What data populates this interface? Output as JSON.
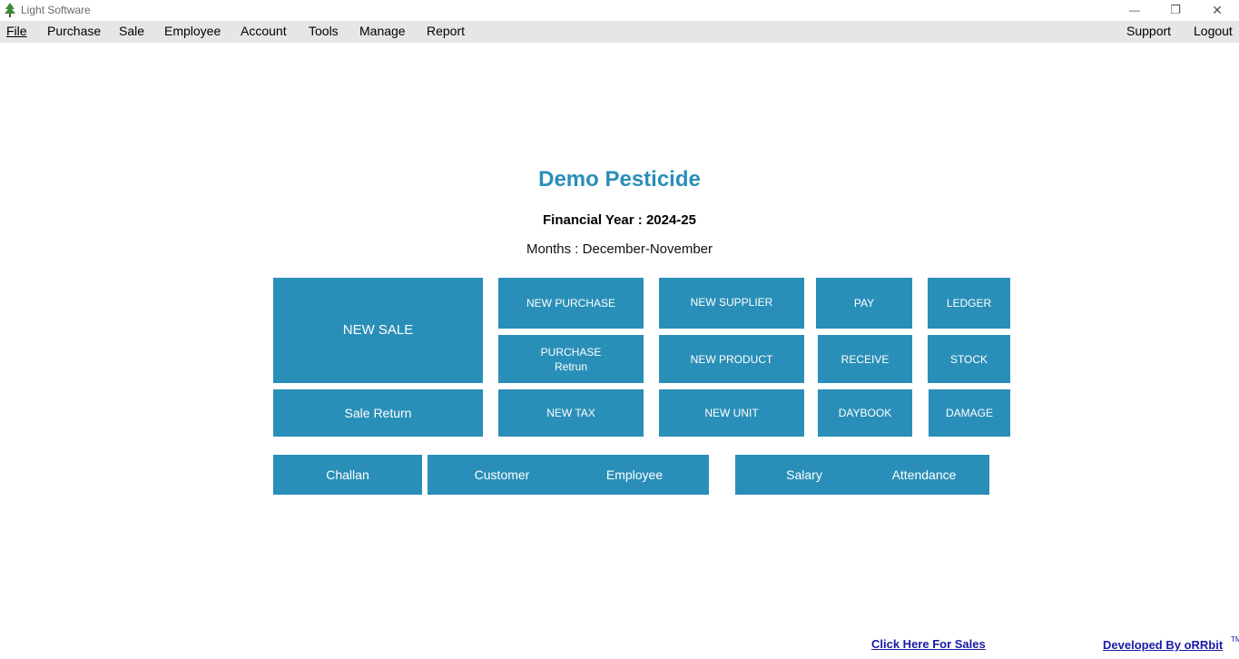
{
  "window": {
    "title": "Light Software",
    "controls": {
      "minimize": "—",
      "restore": "❐",
      "close": "✕"
    }
  },
  "menu": {
    "left": [
      "File",
      "Purchase",
      "Sale",
      "Employee",
      "Account",
      "Tools",
      "Manage",
      "Report"
    ],
    "right": [
      "Support",
      "Logout"
    ]
  },
  "header": {
    "company": "Demo Pesticide",
    "financial_year": "Financial Year : 2024-25",
    "months": "Months : December-November"
  },
  "tiles": {
    "new_sale": "NEW SALE",
    "new_purchase": "NEW PURCHASE",
    "new_supplier": "NEW SUPPLIER",
    "pay": "PAY",
    "ledger": "LEDGER",
    "purchase_return_line1": "PURCHASE",
    "purchase_return_line2": "Retrun",
    "new_product": "NEW PRODUCT",
    "receive": "RECEIVE",
    "stock": "STOCK",
    "sale_return": "Sale Return",
    "new_tax": "NEW TAX",
    "new_unit": "NEW UNIT",
    "daybook": "DAYBOOK",
    "damage": "DAMAGE",
    "challan": "Challan",
    "customer": "Customer",
    "employee": "Employee",
    "salary": "Salary",
    "attendance": "Attendance"
  },
  "footer": {
    "sales_link": "Click Here For Sales",
    "developer_link": "Developed By oRRbit",
    "trademark": "TM"
  },
  "colors": {
    "tile": "#2a8fb8",
    "company_title": "#2a8fb8",
    "menubar": "#e6e6e6",
    "link": "#1a1aa6"
  }
}
